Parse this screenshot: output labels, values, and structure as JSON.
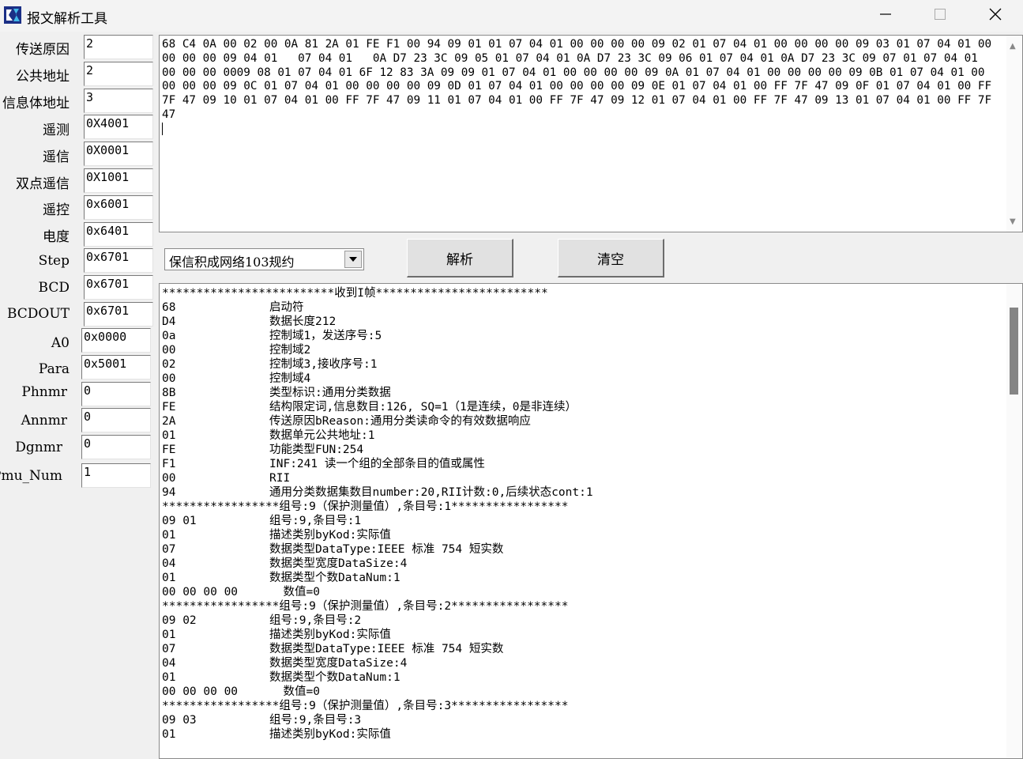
{
  "window": {
    "title": "报文解析工具"
  },
  "params": [
    {
      "label": "传送原因",
      "value": "2"
    },
    {
      "label": "公共地址",
      "value": "2"
    },
    {
      "label": "信息体地址",
      "value": "3"
    },
    {
      "label": "遥测",
      "value": "0X4001"
    },
    {
      "label": "遥信",
      "value": "0X0001"
    },
    {
      "label": "双点遥信",
      "value": "0X1001"
    },
    {
      "label": "遥控",
      "value": "0x6001"
    },
    {
      "label": "电度",
      "value": "0x6401"
    },
    {
      "label": "Step",
      "value": "0x6701"
    },
    {
      "label": "BCD",
      "value": "0x6701"
    },
    {
      "label": "BCDOUT",
      "value": "0x6701"
    },
    {
      "label": "A0",
      "value": "0x0000"
    },
    {
      "label": "Para",
      "value": "0x5001"
    },
    {
      "label": "Phnmr",
      "value": "0"
    },
    {
      "label": "Annmr",
      "value": "0"
    },
    {
      "label": "Dgnmr",
      "value": "0"
    },
    {
      "label": "Pmu_Num",
      "value": "1"
    }
  ],
  "input": {
    "hex": "68 C4 0A 00 02 00 0A 81 2A 01 FE F1 00 94 09 01 01 07 04 01 00 00 00 00 09 02 01 07 04 01 00 00 00 00 09 03 01 07 04 01 00 00 00 00 09 04 01   07 04 01   0A D7 23 3C 09 05 01 07 04 01 0A D7 23 3C 09 06 01 07 04 01 0A D7 23 3C 09 07 01 07 04 01 00 00 00 0009 08 01 07 04 01 6F 12 83 3A 09 09 01 07 04 01 00 00 00 00 09 0A 01 07 04 01 00 00 00 00 09 0B 01 07 04 01 00 00 00 00 09 0C 01 07 04 01 00 00 00 00 09 0D 01 07 04 01 00 00 00 00 09 0E 01 07 04 01 00 FF 7F 47 09 0F 01 07 04 01 00 FF 7F 47 09 10 01 07 04 01 00 FF 7F 47 09 11 01 07 04 01 00 FF 7F 47 09 12 01 07 04 01 00 FF 7F 47 09 13 01 07 04 01 00 FF 7F 47"
  },
  "toolbar": {
    "protocol": "保信积成网络103规约",
    "parse_label": "解析",
    "clear_label": "清空"
  },
  "output": {
    "lines": [
      {
        "hex": "",
        "desc": "*************************收到I帧*************************"
      },
      {
        "hex": "68",
        "desc": "启动符"
      },
      {
        "hex": "D4",
        "desc": "数据长度212"
      },
      {
        "hex": "0a",
        "desc": "控制域1，发送序号:5"
      },
      {
        "hex": "00",
        "desc": "控制域2"
      },
      {
        "hex": "02",
        "desc": "控制域3,接收序号:1"
      },
      {
        "hex": "00",
        "desc": "控制域4"
      },
      {
        "hex": "8B",
        "desc": "类型标识:通用分类数据"
      },
      {
        "hex": "FE",
        "desc": "结构限定词,信息数目:126, SQ=1（1是连续，0是非连续）"
      },
      {
        "hex": "2A",
        "desc": "传送原因bReason:通用分类读命令的有效数据响应"
      },
      {
        "hex": "01",
        "desc": "数据单元公共地址:1"
      },
      {
        "hex": "FE",
        "desc": "功能类型FUN:254"
      },
      {
        "hex": "F1",
        "desc": "INF:241 读一个组的全部条目的值或属性"
      },
      {
        "hex": "00",
        "desc": "RII"
      },
      {
        "hex": "94",
        "desc": "通用分类数据集数目number:20,RII计数:0,后续状态cont:1"
      },
      {
        "hex": "",
        "desc": "*****************组号:9（保护测量值）,条目号:1*****************"
      },
      {
        "hex": "09 01",
        "desc": "组号:9,条目号:1"
      },
      {
        "hex": "01",
        "desc": "描述类别byKod:实际值"
      },
      {
        "hex": "07",
        "desc": "数据类型DataType:IEEE 标准 754 短实数"
      },
      {
        "hex": "04",
        "desc": "数据类型宽度DataSize:4"
      },
      {
        "hex": "01",
        "desc": "数据类型个数DataNum:1"
      },
      {
        "hex": "00 00 00 00",
        "desc": "  数值=0"
      },
      {
        "hex": "",
        "desc": "*****************组号:9（保护测量值）,条目号:2*****************"
      },
      {
        "hex": "09 02",
        "desc": "组号:9,条目号:2"
      },
      {
        "hex": "01",
        "desc": "描述类别byKod:实际值"
      },
      {
        "hex": "07",
        "desc": "数据类型DataType:IEEE 标准 754 短实数"
      },
      {
        "hex": "04",
        "desc": "数据类型宽度DataSize:4"
      },
      {
        "hex": "01",
        "desc": "数据类型个数DataNum:1"
      },
      {
        "hex": "00 00 00 00",
        "desc": "  数值=0"
      },
      {
        "hex": "",
        "desc": "*****************组号:9（保护测量值）,条目号:3*****************"
      },
      {
        "hex": "09 03",
        "desc": "组号:9,条目号:3"
      },
      {
        "hex": "01",
        "desc": "描述类别byKod:实际值"
      }
    ]
  }
}
